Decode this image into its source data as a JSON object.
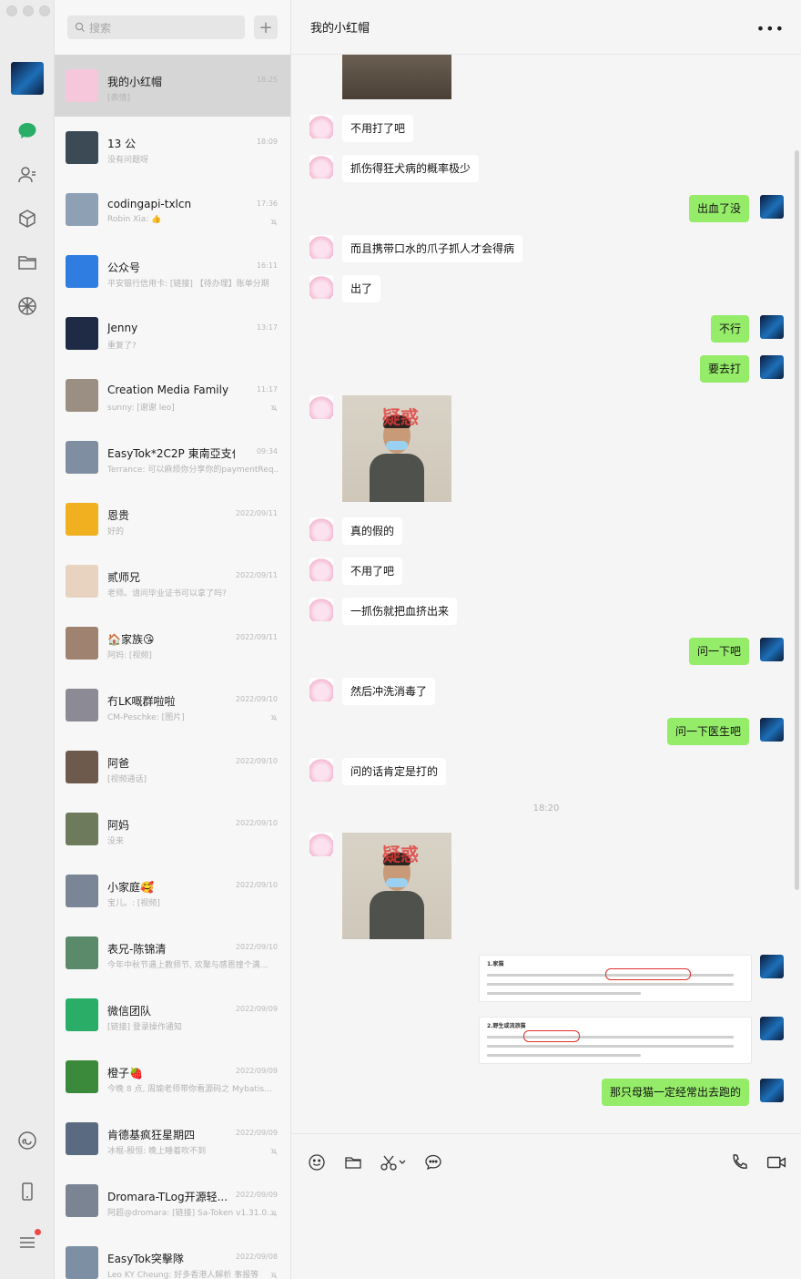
{
  "search": {
    "placeholder": "搜索",
    "add_label": "+"
  },
  "chat": {
    "title": "我的小红帽",
    "more_label": "•••",
    "messages": [
      {
        "from": "peer",
        "type": "text",
        "text": "不用打了吧"
      },
      {
        "from": "peer",
        "type": "text",
        "text": "抓伤得狂犬病的概率极少"
      },
      {
        "from": "me",
        "type": "text",
        "text": "出血了没"
      },
      {
        "from": "peer",
        "type": "text",
        "text": "而且携带口水的爪子抓人才会得病"
      },
      {
        "from": "peer",
        "type": "text",
        "text": "出了"
      },
      {
        "from": "me",
        "type": "text",
        "text": "不行"
      },
      {
        "from": "me",
        "type": "text",
        "text": "要去打"
      },
      {
        "from": "peer",
        "type": "image",
        "watermark": "疑惑"
      },
      {
        "from": "peer",
        "type": "text",
        "text": "真的假的"
      },
      {
        "from": "peer",
        "type": "text",
        "text": "不用了吧"
      },
      {
        "from": "peer",
        "type": "text",
        "text": "一抓伤就把血挤出来"
      },
      {
        "from": "me",
        "type": "text",
        "text": "问一下吧"
      },
      {
        "from": "peer",
        "type": "text",
        "text": "然后冲洗消毒了"
      },
      {
        "from": "me",
        "type": "text",
        "text": "问一下医生吧"
      },
      {
        "from": "peer",
        "type": "text",
        "text": "问的话肯定是打的"
      },
      {
        "from": "time",
        "text": "18:20"
      },
      {
        "from": "peer",
        "type": "image",
        "watermark": "疑惑"
      },
      {
        "from": "me",
        "type": "doc",
        "heading": "1.家猫"
      },
      {
        "from": "me",
        "type": "doc",
        "heading": "2.野生或流浪猫"
      },
      {
        "from": "me",
        "type": "text",
        "text": "那只母猫一定经常出去跑的"
      }
    ]
  },
  "conversations": [
    {
      "name": "我的小红帽",
      "time": "18:25",
      "preview": "[表情]",
      "muted": false,
      "active": true,
      "avatar_color": "#f6c6da"
    },
    {
      "name": "13 公",
      "time": "18:09",
      "preview": "没有问题呀",
      "muted": false,
      "avatar_color": "#3b4a55"
    },
    {
      "name": "codingapi-txlcn",
      "time": "17:36",
      "preview": "Robin Xia: 👍",
      "muted": true,
      "avatar_color": "#8ea0b4"
    },
    {
      "name": "公众号",
      "time": "16:11",
      "preview": "平安银行信用卡: [链接] 【待办理】账单分期",
      "muted": false,
      "avatar_color": "#2f7de1"
    },
    {
      "name": "Jenny",
      "time": "13:17",
      "preview": "重复了?",
      "muted": false,
      "avatar_color": "#1f2a44"
    },
    {
      "name": "Creation Media Family",
      "time": "11:17",
      "preview": "sunny: [谢谢 leo]",
      "muted": true,
      "avatar_color": "#9b8f84"
    },
    {
      "name": "EasyTok*2C2P 東南亞支付",
      "time": "09:34",
      "preview": "Terrance: 可以麻烦你分享你的paymentReq...",
      "muted": false,
      "avatar_color": "#7f8ea0"
    },
    {
      "name": "恩贵",
      "time": "2022/09/11",
      "preview": "好的",
      "muted": false,
      "avatar_color": "#f0b020"
    },
    {
      "name": "贰师兄",
      "time": "2022/09/11",
      "preview": "老师。请问毕业证书可以拿了吗?",
      "muted": false,
      "avatar_color": "#e8d2c0"
    },
    {
      "name": "🏠家族😘",
      "time": "2022/09/11",
      "preview": "阿妈: [视频]",
      "muted": false,
      "avatar_color": "#a08270"
    },
    {
      "name": "冇LK嘅群啦啦",
      "time": "2022/09/10",
      "preview": "CM-Peschke: [图片]",
      "muted": true,
      "avatar_color": "#8b8a95"
    },
    {
      "name": "阿爸",
      "time": "2022/09/10",
      "preview": "[视频通话]",
      "muted": false,
      "avatar_color": "#6d5a4c"
    },
    {
      "name": "阿妈",
      "time": "2022/09/10",
      "preview": "没来",
      "muted": false,
      "avatar_color": "#6d7a5c"
    },
    {
      "name": "小家庭🥰",
      "time": "2022/09/10",
      "preview": "宝儿。: [视频]",
      "muted": false,
      "avatar_color": "#7a8695"
    },
    {
      "name": "表兄-陈锦清",
      "time": "2022/09/10",
      "preview": "今年中秋节遇上教师节, 欢聚与感恩撞个满...",
      "muted": false,
      "avatar_color": "#5a8a6a"
    },
    {
      "name": "微信团队",
      "time": "2022/09/09",
      "preview": "[链接] 登录操作通知",
      "muted": false,
      "avatar_color": "#2aae67"
    },
    {
      "name": "橙子🍓",
      "time": "2022/09/09",
      "preview": "今晚 8 点, 周瑜老师带你看源码之 Mybatis...",
      "muted": false,
      "avatar_color": "#3b8a3b"
    },
    {
      "name": "肯德基疯狂星期四",
      "time": "2022/09/09",
      "preview": "冰棍-殷恒: 晚上睡着吹不到",
      "muted": true,
      "avatar_color": "#5a6a80"
    },
    {
      "name": "Dromara-TLog开源轻...",
      "time": "2022/09/09",
      "preview": "阿超@dromara: [链接] Sa-Token v1.31.0...",
      "muted": true,
      "avatar_color": "#7b8493"
    },
    {
      "name": "EasyTok突擊隊",
      "time": "2022/09/08",
      "preview": "Leo KY Cheung: 好多香港人解析 事报等",
      "muted": true,
      "avatar_color": "#7d8fa3"
    }
  ]
}
